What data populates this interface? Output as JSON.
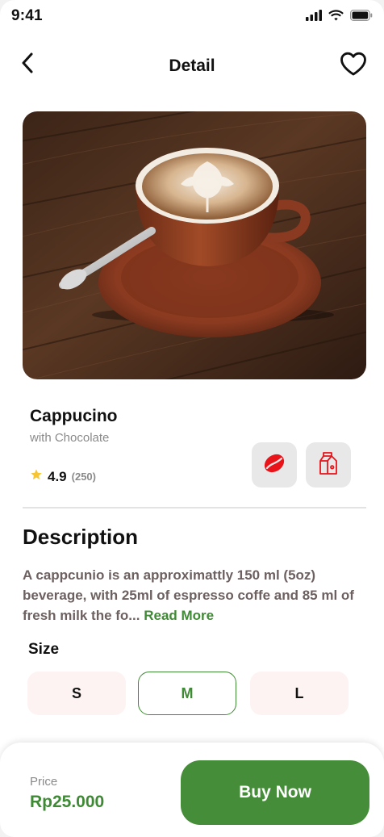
{
  "status_bar": {
    "time": "9:41",
    "icons": [
      "signal-icon",
      "wifi-icon",
      "battery-icon"
    ]
  },
  "header": {
    "title": "Detail",
    "back_icon": "chevron-left-icon",
    "favorite_icon": "heart-icon"
  },
  "product": {
    "image": "cappuccino-photo",
    "name": "Cappucino",
    "subtitle": "with Chocolate",
    "rating": "4.9",
    "rating_count": "(250)",
    "options": [
      {
        "icon": "coffee-bean-icon"
      },
      {
        "icon": "milk-carton-icon"
      }
    ]
  },
  "description": {
    "title": "Description",
    "text": "A cappcunio is an approximattly 150 ml (5oz) beverage, with 25ml of espresso coffe and 85 ml of fresh milk the fo...",
    "read_more": "Read More"
  },
  "size": {
    "label": "Size",
    "options": [
      "S",
      "M",
      "L"
    ],
    "selected": "M"
  },
  "checkout": {
    "price_label": "Price",
    "price": "Rp25.000",
    "buy_label": "Buy Now"
  },
  "colors": {
    "accent": "#458d38",
    "accent_text": "#3f8a34",
    "size_bg": "#fdf3f2",
    "icon_red": "#e8141a"
  }
}
